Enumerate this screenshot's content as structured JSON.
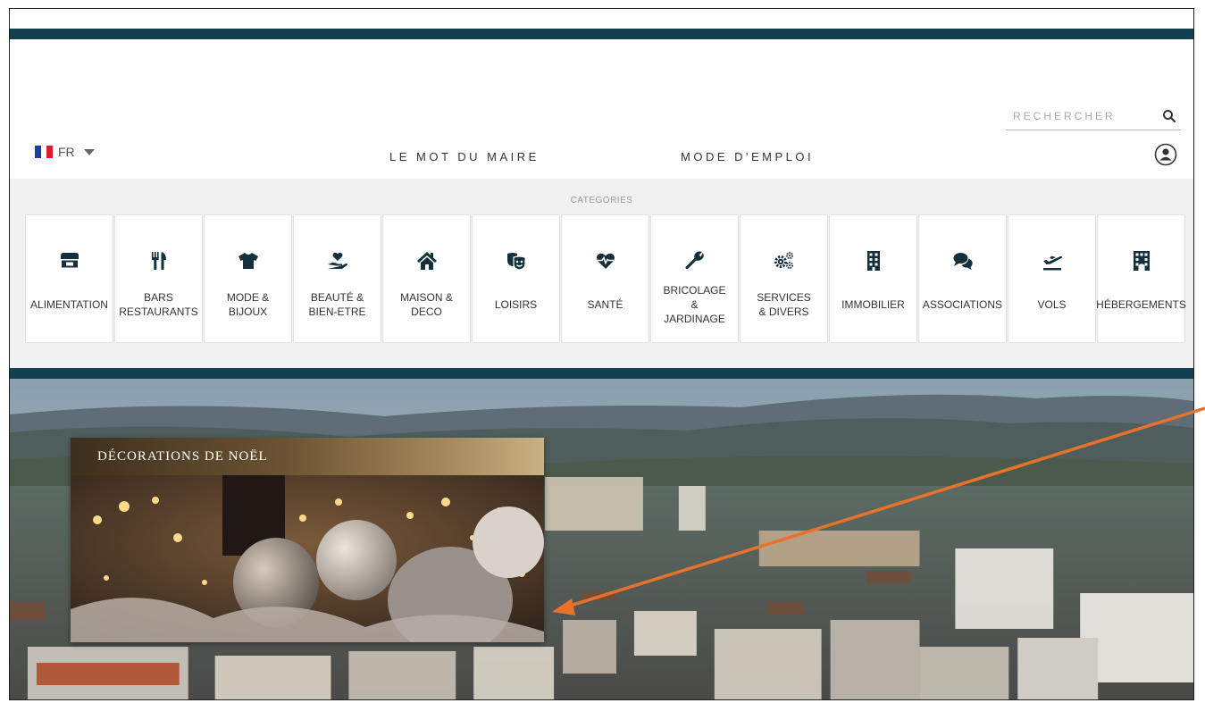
{
  "header": {
    "language": "FR",
    "nav": [
      {
        "label": "LE MOT DU MAIRE"
      },
      {
        "label": "MODE D'EMPLOI"
      }
    ],
    "search": {
      "placeholder": "RECHERCHER"
    }
  },
  "categories": {
    "title": "CATEGORIES",
    "items": [
      {
        "label": "ALIMENTATION",
        "icon": "store-icon"
      },
      {
        "label": "BARS\nRESTAURANTS",
        "icon": "utensils-icon"
      },
      {
        "label": "MODE &\nBIJOUX",
        "icon": "tshirt-icon"
      },
      {
        "label": "BEAUTÉ &\nBIEN-ETRE",
        "icon": "hand-heart-icon"
      },
      {
        "label": "MAISON &\nDECO",
        "icon": "house-icon"
      },
      {
        "label": "LOISIRS",
        "icon": "theater-masks-icon"
      },
      {
        "label": "SANTÉ",
        "icon": "heartbeat-icon"
      },
      {
        "label": "BRICOLAGE\n&\nJARDINAGE",
        "icon": "wrench-icon"
      },
      {
        "label": "SERVICES\n& DIVERS",
        "icon": "gears-icon"
      },
      {
        "label": "IMMOBILIER",
        "icon": "building-icon"
      },
      {
        "label": "ASSOCIATIONS",
        "icon": "comments-icon"
      },
      {
        "label": "VOLS",
        "icon": "plane-departure-icon"
      },
      {
        "label": "HÉBERGEMENTS",
        "icon": "hotel-icon"
      }
    ]
  },
  "promo": {
    "title": "DÉCORATIONS DE NOËL"
  },
  "colors": {
    "brand_dark": "#12404f",
    "panel_bg": "#f1f1f1",
    "annotation_arrow": "#e8722a"
  }
}
